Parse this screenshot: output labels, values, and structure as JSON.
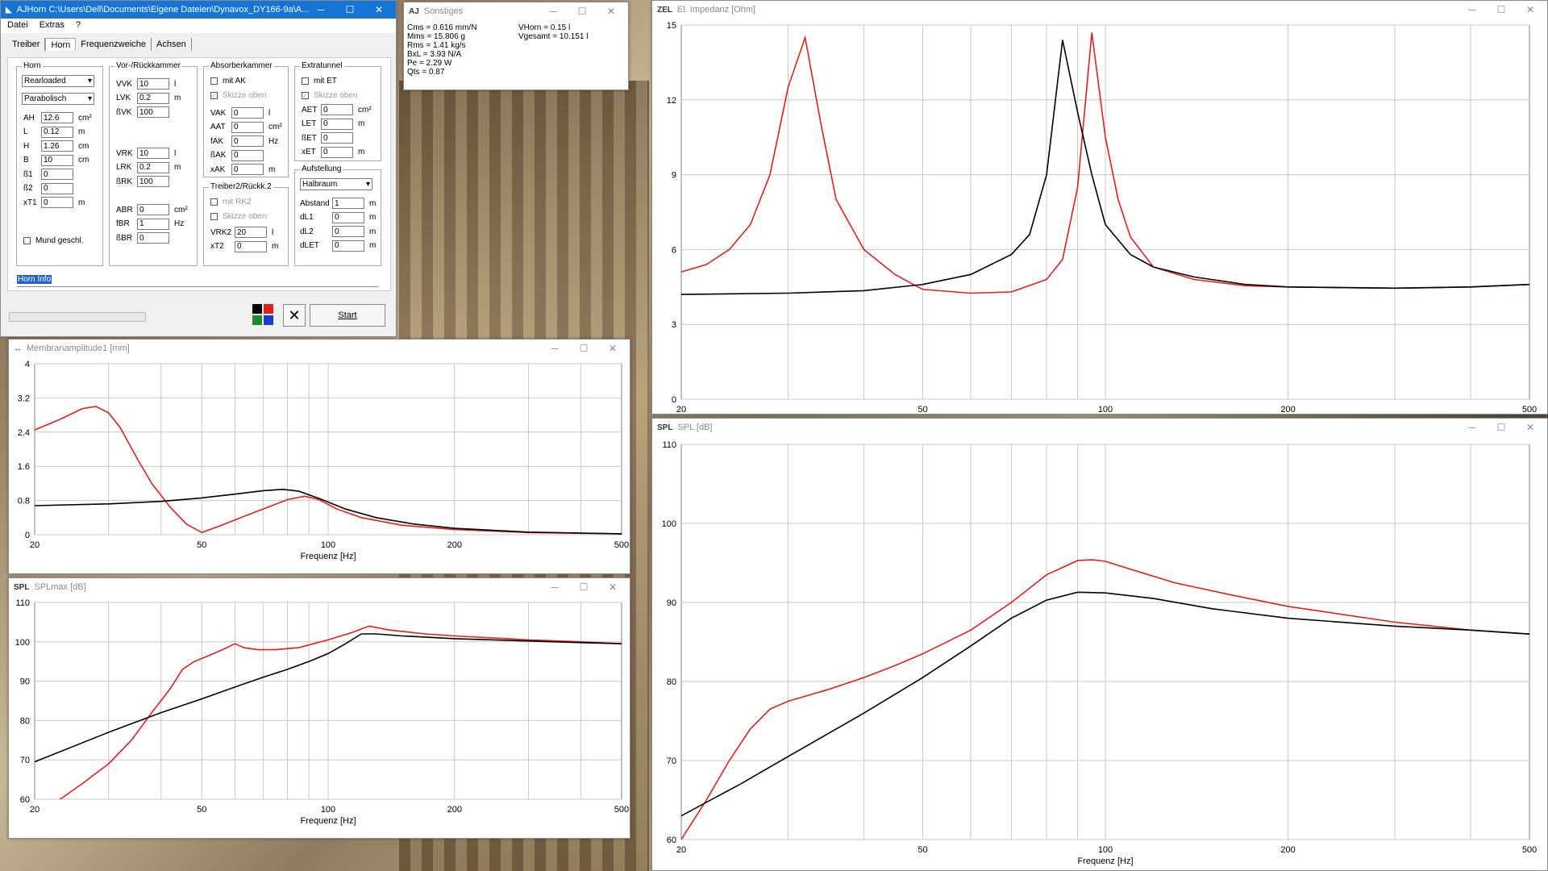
{
  "main": {
    "title": "AJHorn  C:\\Users\\Dell\\Documents\\Eigene Dateien\\Dynavox_DY166-9a\\A...",
    "menu": [
      "Datei",
      "Extras",
      "?"
    ],
    "tabs": [
      "Treiber",
      "Horn",
      "Frequenzweiche",
      "Achsen"
    ],
    "horn": {
      "title": "Horn",
      "type": "Rearloaded",
      "shape": "Parabolisch",
      "fields": [
        {
          "label": "AH",
          "value": "12.6",
          "unit": "cm²"
        },
        {
          "label": "L",
          "value": "0.12",
          "unit": "m"
        },
        {
          "label": "H",
          "value": "1.26",
          "unit": "cm"
        },
        {
          "label": "B",
          "value": "10",
          "unit": "cm"
        },
        {
          "label": "ß1",
          "value": "0",
          "unit": ""
        },
        {
          "label": "ß2",
          "value": "0",
          "unit": ""
        },
        {
          "label": "xT1",
          "value": "0",
          "unit": "m"
        }
      ],
      "mund": "Mund geschl."
    },
    "kammer": {
      "title": "Vor-/Rückkammer",
      "fields1": [
        {
          "label": "VVK",
          "value": "10",
          "unit": "l"
        },
        {
          "label": "LVK",
          "value": "0.2",
          "unit": "m"
        },
        {
          "label": "ßVK",
          "value": "100",
          "unit": ""
        }
      ],
      "fields2": [
        {
          "label": "VRK",
          "value": "10",
          "unit": "l"
        },
        {
          "label": "LRK",
          "value": "0.2",
          "unit": "m"
        },
        {
          "label": "ßRK",
          "value": "100",
          "unit": ""
        }
      ],
      "fields3": [
        {
          "label": "ABR",
          "value": "0",
          "unit": "cm²"
        },
        {
          "label": "fBR",
          "value": "1",
          "unit": "Hz"
        },
        {
          "label": "ßBR",
          "value": "0",
          "unit": ""
        }
      ]
    },
    "absorber": {
      "title": "Absorberkammer",
      "chk1": "mit AK",
      "chk2": "Skizze oben",
      "fields": [
        {
          "label": "VAK",
          "value": "0",
          "unit": "l"
        },
        {
          "label": "AAT",
          "value": "0",
          "unit": "cm²"
        },
        {
          "label": "fAK",
          "value": "0",
          "unit": "Hz"
        },
        {
          "label": "ßAK",
          "value": "0",
          "unit": ""
        },
        {
          "label": "xAK",
          "value": "0",
          "unit": "m"
        }
      ]
    },
    "treiber2": {
      "title": "Treiber2/Rückk.2",
      "chk1": "mit RK2",
      "chk2": "Skizze oben",
      "fields": [
        {
          "label": "VRK2",
          "value": "20",
          "unit": "l"
        },
        {
          "label": "xT2",
          "value": "0",
          "unit": "m"
        }
      ]
    },
    "extra": {
      "title": "Extratunnel",
      "chk1": "mit ET",
      "chk2": "Skizze oben",
      "fields": [
        {
          "label": "AET",
          "value": "0",
          "unit": "cm²"
        },
        {
          "label": "LET",
          "value": "0",
          "unit": "m"
        },
        {
          "label": "ßET",
          "value": "0",
          "unit": ""
        },
        {
          "label": "xET",
          "value": "0",
          "unit": "m"
        }
      ]
    },
    "aufstellung": {
      "title": "Aufstellung",
      "mode": "Halbraum",
      "fields": [
        {
          "label": "Abstand",
          "value": "1",
          "unit": "m"
        },
        {
          "label": "dL1",
          "value": "0",
          "unit": "m"
        },
        {
          "label": "dL2",
          "value": "0",
          "unit": "m"
        },
        {
          "label": "dLET",
          "value": "0",
          "unit": "m"
        }
      ]
    },
    "info": "Horn Info",
    "start": "Start"
  },
  "sonstiges": {
    "title": "Sonstiges",
    "left": [
      "Cms = 0.616 mm/N",
      "Mms = 15.806 g",
      "Rms = 1.41 kg/s",
      "BxL = 3.93 N/A",
      "Pe = 2.29 W",
      "Qts = 0.87"
    ],
    "right": [
      "VHorn = 0.15 l",
      "Vgesamt = 10.151 l"
    ]
  },
  "colors": {
    "red": "#e0201e",
    "black": "#000000",
    "grid": "#c8c8c8",
    "titlebar": "#1574d6"
  },
  "chart_data": [
    {
      "id": "impedanz",
      "type": "line",
      "title": "El. Impedanz [Ohm]",
      "icon": "ZEL",
      "xlabel": "",
      "xscale": "log",
      "xlim": [
        20,
        500
      ],
      "xticks": [
        20,
        50,
        100,
        200,
        500
      ],
      "ylim": [
        0,
        15
      ],
      "yticks": [
        0,
        3,
        6,
        9,
        12,
        15
      ],
      "series": [
        {
          "color": "#e0201e",
          "points": [
            [
              20,
              5.1
            ],
            [
              22,
              5.4
            ],
            [
              24,
              6.0
            ],
            [
              26,
              7.0
            ],
            [
              28,
              9.0
            ],
            [
              30,
              12.5
            ],
            [
              32,
              14.5
            ],
            [
              34,
              11.0
            ],
            [
              36,
              8.0
            ],
            [
              40,
              6.0
            ],
            [
              45,
              5.0
            ],
            [
              50,
              4.4
            ],
            [
              60,
              4.25
            ],
            [
              70,
              4.3
            ],
            [
              80,
              4.8
            ],
            [
              85,
              5.6
            ],
            [
              90,
              8.5
            ],
            [
              95,
              14.7
            ],
            [
              100,
              10.5
            ],
            [
              105,
              8.0
            ],
            [
              110,
              6.5
            ],
            [
              120,
              5.3
            ],
            [
              140,
              4.8
            ],
            [
              170,
              4.55
            ],
            [
              200,
              4.5
            ],
            [
              300,
              4.45
            ],
            [
              400,
              4.5
            ],
            [
              500,
              4.6
            ]
          ]
        },
        {
          "color": "#000000",
          "points": [
            [
              20,
              4.2
            ],
            [
              30,
              4.25
            ],
            [
              40,
              4.35
            ],
            [
              50,
              4.6
            ],
            [
              60,
              5.0
            ],
            [
              70,
              5.8
            ],
            [
              75,
              6.6
            ],
            [
              80,
              9.0
            ],
            [
              85,
              14.4
            ],
            [
              90,
              11.5
            ],
            [
              95,
              9.0
            ],
            [
              100,
              7.0
            ],
            [
              110,
              5.8
            ],
            [
              120,
              5.3
            ],
            [
              140,
              4.9
            ],
            [
              170,
              4.6
            ],
            [
              200,
              4.5
            ],
            [
              300,
              4.45
            ],
            [
              400,
              4.5
            ],
            [
              500,
              4.6
            ]
          ]
        }
      ]
    },
    {
      "id": "membran",
      "type": "line",
      "title": "Membranamplitude1 [mm]",
      "icon": "↔",
      "xlabel": "Frequenz [Hz]",
      "xscale": "log",
      "xlim": [
        20,
        500
      ],
      "xticks": [
        20,
        50,
        100,
        200,
        500
      ],
      "ylim": [
        0,
        4
      ],
      "yticks": [
        0,
        0.8,
        1.6,
        2.4,
        3.2,
        4
      ],
      "yticklabels": [
        "0",
        "0.8",
        "1.6",
        "2.4",
        "3.2",
        "4"
      ],
      "series": [
        {
          "color": "#e0201e",
          "points": [
            [
              20,
              2.45
            ],
            [
              23,
              2.7
            ],
            [
              26,
              2.95
            ],
            [
              28,
              3.0
            ],
            [
              30,
              2.85
            ],
            [
              32,
              2.5
            ],
            [
              35,
              1.8
            ],
            [
              38,
              1.2
            ],
            [
              42,
              0.65
            ],
            [
              46,
              0.25
            ],
            [
              50,
              0.05
            ],
            [
              55,
              0.2
            ],
            [
              62,
              0.4
            ],
            [
              70,
              0.6
            ],
            [
              80,
              0.82
            ],
            [
              88,
              0.9
            ],
            [
              95,
              0.82
            ],
            [
              105,
              0.6
            ],
            [
              120,
              0.4
            ],
            [
              150,
              0.22
            ],
            [
              200,
              0.12
            ],
            [
              300,
              0.05
            ],
            [
              500,
              0.02
            ]
          ]
        },
        {
          "color": "#000000",
          "points": [
            [
              20,
              0.68
            ],
            [
              30,
              0.72
            ],
            [
              40,
              0.78
            ],
            [
              50,
              0.86
            ],
            [
              60,
              0.95
            ],
            [
              70,
              1.03
            ],
            [
              78,
              1.06
            ],
            [
              85,
              1.02
            ],
            [
              95,
              0.85
            ],
            [
              110,
              0.6
            ],
            [
              130,
              0.4
            ],
            [
              160,
              0.25
            ],
            [
              200,
              0.15
            ],
            [
              300,
              0.06
            ],
            [
              500,
              0.02
            ]
          ]
        }
      ]
    },
    {
      "id": "splmax",
      "type": "line",
      "title": "SPLmax [dB]",
      "icon": "SPL",
      "xlabel": "Frequenz [Hz]",
      "xscale": "log",
      "xlim": [
        20,
        500
      ],
      "xticks": [
        20,
        50,
        100,
        200,
        500
      ],
      "ylim": [
        60,
        110
      ],
      "yticks": [
        60,
        70,
        80,
        90,
        100,
        110
      ],
      "series": [
        {
          "color": "#e0201e",
          "points": [
            [
              20,
              57
            ],
            [
              23,
              60
            ],
            [
              26,
              64
            ],
            [
              30,
              69
            ],
            [
              34,
              75
            ],
            [
              38,
              82
            ],
            [
              42,
              88
            ],
            [
              45,
              93
            ],
            [
              48,
              95
            ],
            [
              52,
              96.5
            ],
            [
              56,
              98
            ],
            [
              60,
              99.5
            ],
            [
              63,
              98.5
            ],
            [
              68,
              98
            ],
            [
              75,
              98
            ],
            [
              85,
              98.5
            ],
            [
              100,
              100.5
            ],
            [
              115,
              102.5
            ],
            [
              125,
              104
            ],
            [
              140,
              103
            ],
            [
              170,
              102
            ],
            [
              200,
              101.5
            ],
            [
              300,
              100.5
            ],
            [
              400,
              100
            ],
            [
              500,
              99.5
            ]
          ]
        },
        {
          "color": "#000000",
          "points": [
            [
              20,
              69.5
            ],
            [
              30,
              77
            ],
            [
              40,
              82
            ],
            [
              50,
              85.5
            ],
            [
              60,
              88.5
            ],
            [
              70,
              91
            ],
            [
              80,
              93
            ],
            [
              90,
              95
            ],
            [
              100,
              97
            ],
            [
              110,
              99.5
            ],
            [
              120,
              102
            ],
            [
              130,
              102
            ],
            [
              150,
              101.5
            ],
            [
              200,
              100.8
            ],
            [
              300,
              100.2
            ],
            [
              400,
              99.8
            ],
            [
              500,
              99.5
            ]
          ]
        }
      ]
    },
    {
      "id": "spl",
      "type": "line",
      "title": "SPL [dB]",
      "icon": "SPL",
      "xlabel": "Frequenz [Hz]",
      "xscale": "log",
      "xlim": [
        20,
        500
      ],
      "xticks": [
        20,
        50,
        100,
        200,
        500
      ],
      "ylim": [
        60,
        110
      ],
      "yticks": [
        60,
        70,
        80,
        90,
        100,
        110
      ],
      "series": [
        {
          "color": "#e0201e",
          "points": [
            [
              20,
              60
            ],
            [
              22,
              65
            ],
            [
              24,
              70
            ],
            [
              26,
              74
            ],
            [
              28,
              76.5
            ],
            [
              30,
              77.5
            ],
            [
              35,
              79
            ],
            [
              40,
              80.5
            ],
            [
              45,
              82
            ],
            [
              50,
              83.5
            ],
            [
              60,
              86.5
            ],
            [
              70,
              90
            ],
            [
              80,
              93.5
            ],
            [
              90,
              95.3
            ],
            [
              95,
              95.4
            ],
            [
              100,
              95.2
            ],
            [
              110,
              94.2
            ],
            [
              130,
              92.5
            ],
            [
              160,
              91
            ],
            [
              200,
              89.5
            ],
            [
              300,
              87.5
            ],
            [
              400,
              86.5
            ],
            [
              500,
              86
            ]
          ]
        },
        {
          "color": "#000000",
          "points": [
            [
              20,
              63
            ],
            [
              25,
              67
            ],
            [
              30,
              70.5
            ],
            [
              40,
              76
            ],
            [
              50,
              80.5
            ],
            [
              60,
              84.5
            ],
            [
              70,
              88
            ],
            [
              80,
              90.3
            ],
            [
              90,
              91.3
            ],
            [
              100,
              91.2
            ],
            [
              120,
              90.5
            ],
            [
              150,
              89.2
            ],
            [
              200,
              88
            ],
            [
              300,
              87
            ],
            [
              400,
              86.5
            ],
            [
              500,
              86
            ]
          ]
        }
      ]
    }
  ]
}
